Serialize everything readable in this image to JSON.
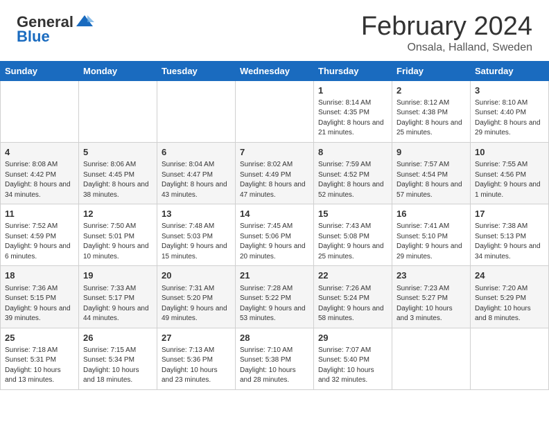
{
  "header": {
    "logo_general": "General",
    "logo_blue": "Blue",
    "title": "February 2024",
    "subtitle": "Onsala, Halland, Sweden"
  },
  "days_of_week": [
    "Sunday",
    "Monday",
    "Tuesday",
    "Wednesday",
    "Thursday",
    "Friday",
    "Saturday"
  ],
  "weeks": [
    [
      {
        "day": "",
        "info": ""
      },
      {
        "day": "",
        "info": ""
      },
      {
        "day": "",
        "info": ""
      },
      {
        "day": "",
        "info": ""
      },
      {
        "day": "1",
        "info": "Sunrise: 8:14 AM\nSunset: 4:35 PM\nDaylight: 8 hours and 21 minutes."
      },
      {
        "day": "2",
        "info": "Sunrise: 8:12 AM\nSunset: 4:38 PM\nDaylight: 8 hours and 25 minutes."
      },
      {
        "day": "3",
        "info": "Sunrise: 8:10 AM\nSunset: 4:40 PM\nDaylight: 8 hours and 29 minutes."
      }
    ],
    [
      {
        "day": "4",
        "info": "Sunrise: 8:08 AM\nSunset: 4:42 PM\nDaylight: 8 hours and 34 minutes."
      },
      {
        "day": "5",
        "info": "Sunrise: 8:06 AM\nSunset: 4:45 PM\nDaylight: 8 hours and 38 minutes."
      },
      {
        "day": "6",
        "info": "Sunrise: 8:04 AM\nSunset: 4:47 PM\nDaylight: 8 hours and 43 minutes."
      },
      {
        "day": "7",
        "info": "Sunrise: 8:02 AM\nSunset: 4:49 PM\nDaylight: 8 hours and 47 minutes."
      },
      {
        "day": "8",
        "info": "Sunrise: 7:59 AM\nSunset: 4:52 PM\nDaylight: 8 hours and 52 minutes."
      },
      {
        "day": "9",
        "info": "Sunrise: 7:57 AM\nSunset: 4:54 PM\nDaylight: 8 hours and 57 minutes."
      },
      {
        "day": "10",
        "info": "Sunrise: 7:55 AM\nSunset: 4:56 PM\nDaylight: 9 hours and 1 minute."
      }
    ],
    [
      {
        "day": "11",
        "info": "Sunrise: 7:52 AM\nSunset: 4:59 PM\nDaylight: 9 hours and 6 minutes."
      },
      {
        "day": "12",
        "info": "Sunrise: 7:50 AM\nSunset: 5:01 PM\nDaylight: 9 hours and 10 minutes."
      },
      {
        "day": "13",
        "info": "Sunrise: 7:48 AM\nSunset: 5:03 PM\nDaylight: 9 hours and 15 minutes."
      },
      {
        "day": "14",
        "info": "Sunrise: 7:45 AM\nSunset: 5:06 PM\nDaylight: 9 hours and 20 minutes."
      },
      {
        "day": "15",
        "info": "Sunrise: 7:43 AM\nSunset: 5:08 PM\nDaylight: 9 hours and 25 minutes."
      },
      {
        "day": "16",
        "info": "Sunrise: 7:41 AM\nSunset: 5:10 PM\nDaylight: 9 hours and 29 minutes."
      },
      {
        "day": "17",
        "info": "Sunrise: 7:38 AM\nSunset: 5:13 PM\nDaylight: 9 hours and 34 minutes."
      }
    ],
    [
      {
        "day": "18",
        "info": "Sunrise: 7:36 AM\nSunset: 5:15 PM\nDaylight: 9 hours and 39 minutes."
      },
      {
        "day": "19",
        "info": "Sunrise: 7:33 AM\nSunset: 5:17 PM\nDaylight: 9 hours and 44 minutes."
      },
      {
        "day": "20",
        "info": "Sunrise: 7:31 AM\nSunset: 5:20 PM\nDaylight: 9 hours and 49 minutes."
      },
      {
        "day": "21",
        "info": "Sunrise: 7:28 AM\nSunset: 5:22 PM\nDaylight: 9 hours and 53 minutes."
      },
      {
        "day": "22",
        "info": "Sunrise: 7:26 AM\nSunset: 5:24 PM\nDaylight: 9 hours and 58 minutes."
      },
      {
        "day": "23",
        "info": "Sunrise: 7:23 AM\nSunset: 5:27 PM\nDaylight: 10 hours and 3 minutes."
      },
      {
        "day": "24",
        "info": "Sunrise: 7:20 AM\nSunset: 5:29 PM\nDaylight: 10 hours and 8 minutes."
      }
    ],
    [
      {
        "day": "25",
        "info": "Sunrise: 7:18 AM\nSunset: 5:31 PM\nDaylight: 10 hours and 13 minutes."
      },
      {
        "day": "26",
        "info": "Sunrise: 7:15 AM\nSunset: 5:34 PM\nDaylight: 10 hours and 18 minutes."
      },
      {
        "day": "27",
        "info": "Sunrise: 7:13 AM\nSunset: 5:36 PM\nDaylight: 10 hours and 23 minutes."
      },
      {
        "day": "28",
        "info": "Sunrise: 7:10 AM\nSunset: 5:38 PM\nDaylight: 10 hours and 28 minutes."
      },
      {
        "day": "29",
        "info": "Sunrise: 7:07 AM\nSunset: 5:40 PM\nDaylight: 10 hours and 32 minutes."
      },
      {
        "day": "",
        "info": ""
      },
      {
        "day": "",
        "info": ""
      }
    ]
  ]
}
